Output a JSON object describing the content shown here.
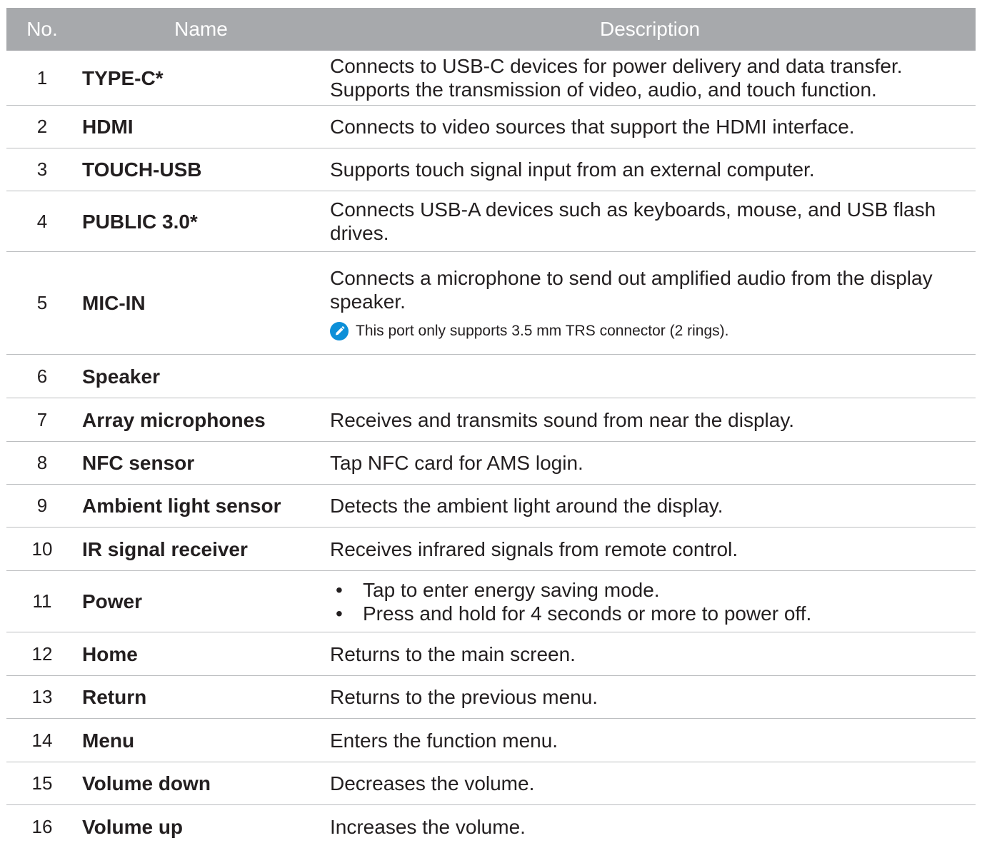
{
  "header": {
    "no": "No.",
    "name": "Name",
    "description": "Description"
  },
  "rows": [
    {
      "no": "1",
      "name": "TYPE-C*",
      "desc": "Connects to USB-C devices for power delivery and data transfer. Supports the transmission of video, audio, and touch function."
    },
    {
      "no": "2",
      "name": "HDMI",
      "desc": "Connects to video sources that support the HDMI interface."
    },
    {
      "no": "3",
      "name": "TOUCH-USB",
      "desc": "Supports touch signal input from an external computer."
    },
    {
      "no": "4",
      "name": "PUBLIC 3.0*",
      "desc": "Connects USB-A devices such as keyboards, mouse, and USB flash drives."
    },
    {
      "no": "5",
      "name": "MIC-IN",
      "desc": "Connects a microphone to send out amplified audio from the display speaker.",
      "note": "This port only supports 3.5 mm TRS connector (2 rings).",
      "note_icon": "pencil-note-icon"
    },
    {
      "no": "6",
      "name": "Speaker",
      "desc": ""
    },
    {
      "no": "7",
      "name": "Array microphones",
      "desc": "Receives and transmits sound from near the display."
    },
    {
      "no": "8",
      "name": "NFC sensor",
      "desc": "Tap NFC card for AMS login."
    },
    {
      "no": "9",
      "name": "Ambient light sensor",
      "desc": "Detects the ambient light around the display."
    },
    {
      "no": "10",
      "name": "IR signal receiver",
      "desc": "Receives infrared signals from remote control."
    },
    {
      "no": "11",
      "name": "Power",
      "bullets": [
        "Tap to enter energy saving mode.",
        "Press and hold for 4 seconds or more to power off."
      ]
    },
    {
      "no": "12",
      "name": "Home",
      "desc": "Returns to the main screen."
    },
    {
      "no": "13",
      "name": "Return",
      "desc": "Returns to the previous menu."
    },
    {
      "no": "14",
      "name": "Menu",
      "desc": "Enters the function menu."
    },
    {
      "no": "15",
      "name": "Volume down",
      "desc": "Decreases the volume."
    },
    {
      "no": "16",
      "name": "Volume up",
      "desc": "Increases the volume."
    }
  ],
  "bullet_glyph": "•",
  "colors": {
    "header_bg": "#a7a9ac",
    "header_text": "#ffffff",
    "rule": "#bcbec0",
    "note_icon": "#0c8fd8"
  }
}
